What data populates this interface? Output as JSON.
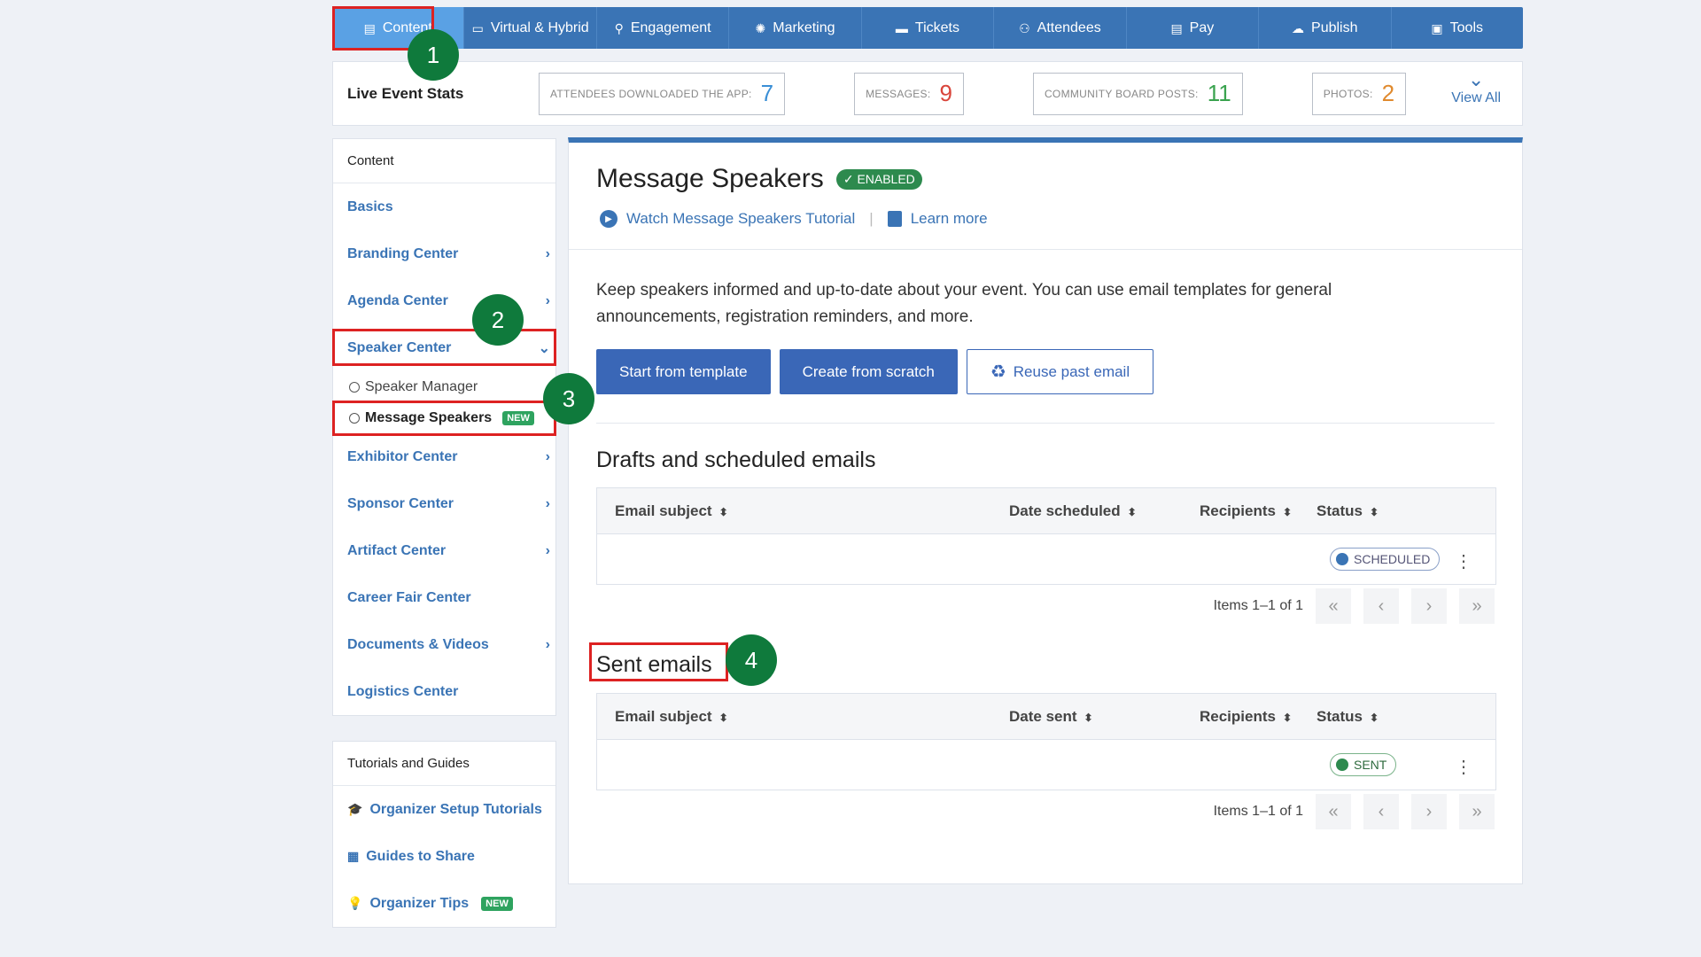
{
  "topnav": {
    "tabs": [
      {
        "label": "Content",
        "icon": "content-icon",
        "glyph": "▤",
        "active": true
      },
      {
        "label": "Virtual & Hybrid",
        "icon": "laptop-icon",
        "glyph": "▭"
      },
      {
        "label": "Engagement",
        "icon": "network-icon",
        "glyph": "⚲"
      },
      {
        "label": "Marketing",
        "icon": "marketing-icon",
        "glyph": "✺"
      },
      {
        "label": "Tickets",
        "icon": "ticket-icon",
        "glyph": "▬"
      },
      {
        "label": "Attendees",
        "icon": "users-icon",
        "glyph": "⚇"
      },
      {
        "label": "Pay",
        "icon": "card-icon",
        "glyph": "▤"
      },
      {
        "label": "Publish",
        "icon": "cloud-upload-icon",
        "glyph": "☁"
      },
      {
        "label": "Tools",
        "icon": "toolbox-icon",
        "glyph": "▣"
      }
    ]
  },
  "stats": {
    "label": "Live Event Stats",
    "items": [
      {
        "label": "ATTENDEES DOWNLOADED THE APP:",
        "value": "7",
        "color": "#3a8fd6"
      },
      {
        "label": "MESSAGES:",
        "value": "9",
        "color": "#d9453b"
      },
      {
        "label": "COMMUNITY BOARD POSTS:",
        "value": "11",
        "color": "#3aa34f"
      },
      {
        "label": "PHOTOS:",
        "value": "2",
        "color": "#e08a2e"
      }
    ],
    "view_all": "View All"
  },
  "sidebar": {
    "header": "Content",
    "items": [
      {
        "label": "Basics",
        "arrow": ""
      },
      {
        "label": "Branding Center",
        "arrow": "›"
      },
      {
        "label": "Agenda Center",
        "arrow": "›"
      },
      {
        "label": "Speaker Center",
        "arrow": "⌄"
      }
    ],
    "sub_items": [
      {
        "label": "Speaker Manager"
      },
      {
        "label": "Message Speakers",
        "badge": "NEW"
      }
    ],
    "items_after": [
      {
        "label": "Exhibitor Center",
        "arrow": "›"
      },
      {
        "label": "Sponsor Center",
        "arrow": "›"
      },
      {
        "label": "Artifact Center",
        "arrow": "›"
      },
      {
        "label": "Career Fair Center",
        "arrow": ""
      },
      {
        "label": "Documents & Videos",
        "arrow": "›"
      },
      {
        "label": "Logistics Center",
        "arrow": ""
      }
    ]
  },
  "guides": {
    "header": "Tutorials and Guides",
    "items": [
      {
        "label": "Organizer Setup Tutorials",
        "icon": "graduation-cap-icon"
      },
      {
        "label": "Guides to Share",
        "icon": "presentation-icon"
      },
      {
        "label": "Organizer Tips",
        "icon": "lightbulb-icon",
        "badge": "NEW"
      }
    ]
  },
  "main": {
    "title": "Message Speakers",
    "enabled_badge": "ENABLED",
    "tutorial_link": "Watch Message Speakers Tutorial",
    "learn_more": "Learn more",
    "description": "Keep speakers informed and up-to-date about your event. You can use email templates for general announcements, registration reminders, and more.",
    "buttons": {
      "template": "Start from template",
      "scratch": "Create from scratch",
      "reuse": "Reuse past email"
    },
    "drafts": {
      "title": "Drafts and scheduled emails",
      "columns": [
        "Email subject",
        "Date scheduled",
        "Recipients",
        "Status"
      ],
      "status": "SCHEDULED",
      "pager": "Items 1–1 of 1"
    },
    "sent": {
      "title": "Sent emails",
      "columns": [
        "Email subject",
        "Date sent",
        "Recipients",
        "Status"
      ],
      "status": "SENT",
      "pager": "Items 1–1 of 1"
    }
  },
  "annotations": [
    "1",
    "2",
    "3",
    "4"
  ]
}
